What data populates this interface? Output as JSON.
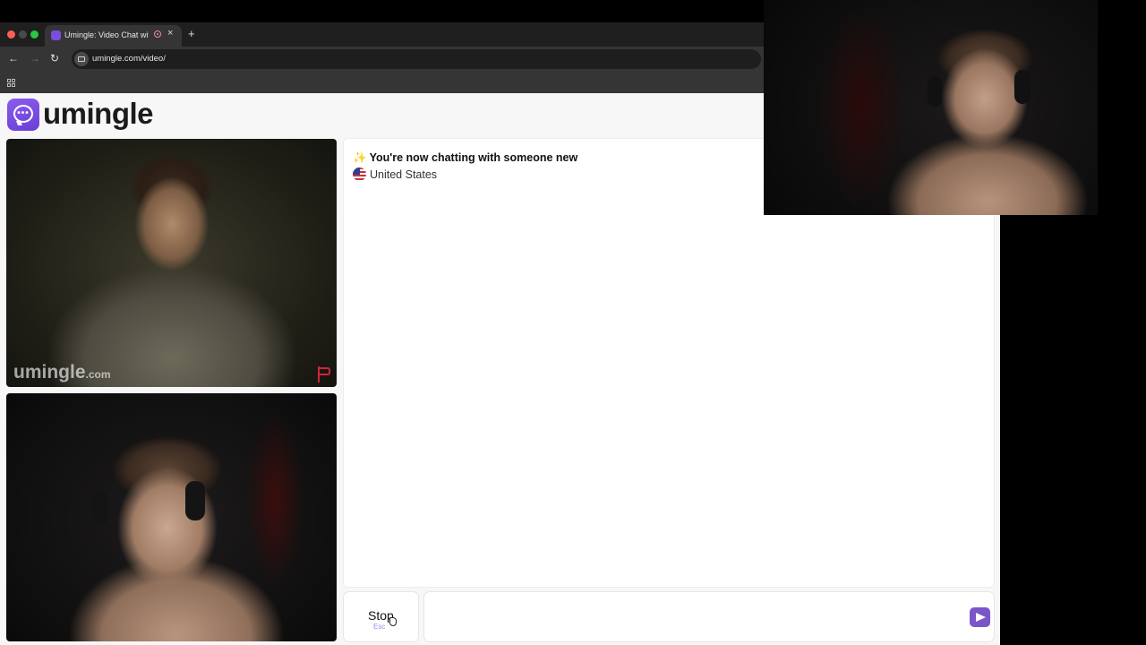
{
  "browser": {
    "tab_title": "Umingle: Video Chat with",
    "tab_close": "×",
    "new_tab": "+",
    "url": "umingle.com/video/",
    "nav_back": "←",
    "nav_forward": "→",
    "nav_reload": "↻"
  },
  "site": {
    "logo_text": "umingle"
  },
  "stranger_video": {
    "watermark": "umingle",
    "watermark_suffix": ".com"
  },
  "chat": {
    "sparkle": "✨",
    "status": "You're now chatting with someone new",
    "country": "United States"
  },
  "controls": {
    "stop_label": "Stop",
    "stop_hint": "Esc",
    "message_value": ""
  },
  "colors": {
    "brand": "#7b4ce0",
    "send": "#7b56c9",
    "report_flag": "#d6213a"
  }
}
